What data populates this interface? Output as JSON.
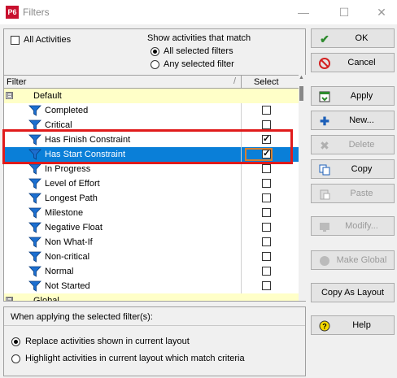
{
  "window": {
    "app_badge": "P6",
    "title": "Filters",
    "minimize_glyph": "—",
    "maximize_glyph": "☐",
    "close_glyph": "✕"
  },
  "options": {
    "all_activities_label": "All Activities",
    "all_activities_checked": false,
    "show_match_label": "Show activities that match",
    "all_selected_label": "All selected filters",
    "any_selected_label": "Any selected filter",
    "match_mode": "all"
  },
  "grid": {
    "col_filter": "Filter",
    "col_sort_glyph": "/",
    "col_select": "Select",
    "groups": [
      {
        "label": "Default",
        "expander": "⊟"
      },
      {
        "label": "Global",
        "expander": "⊟"
      }
    ],
    "items": [
      {
        "label": "Completed",
        "checked": false,
        "selected": false
      },
      {
        "label": "Critical",
        "checked": false,
        "selected": false
      },
      {
        "label": "Has Finish Constraint",
        "checked": true,
        "selected": false
      },
      {
        "label": "Has Start Constraint",
        "checked": true,
        "selected": true
      },
      {
        "label": "In Progress",
        "checked": false,
        "selected": false
      },
      {
        "label": "Level of Effort",
        "checked": false,
        "selected": false
      },
      {
        "label": "Longest Path",
        "checked": false,
        "selected": false
      },
      {
        "label": "Milestone",
        "checked": false,
        "selected": false
      },
      {
        "label": "Negative Float",
        "checked": false,
        "selected": false
      },
      {
        "label": "Non What-If",
        "checked": false,
        "selected": false
      },
      {
        "label": "Non-critical",
        "checked": false,
        "selected": false
      },
      {
        "label": "Normal",
        "checked": false,
        "selected": false
      },
      {
        "label": "Not Started",
        "checked": false,
        "selected": false
      }
    ]
  },
  "apply_mode": {
    "title": "When applying the selected filter(s):",
    "replace_label": "Replace activities shown in current layout",
    "highlight_label": "Highlight activities in current layout which match criteria",
    "mode": "replace"
  },
  "buttons": {
    "ok": {
      "label": "OK",
      "icon": "check-icon",
      "color": "#2e8b2e"
    },
    "cancel": {
      "label": "Cancel",
      "icon": "no-entry-icon",
      "color": "#d42020"
    },
    "apply": {
      "label": "Apply",
      "icon": "apply-icon"
    },
    "new": {
      "label": "New...",
      "icon": "plus-icon"
    },
    "delete": {
      "label": "Delete",
      "icon": "x-icon"
    },
    "copy": {
      "label": "Copy",
      "icon": "copy-icon"
    },
    "paste": {
      "label": "Paste",
      "icon": "paste-icon"
    },
    "modify": {
      "label": "Modify...",
      "icon": "modify-icon"
    },
    "make_global": {
      "label": "Make Global",
      "icon": "globe-icon"
    },
    "copy_as_layout": {
      "label": "Copy As Layout"
    },
    "help": {
      "label": "Help",
      "icon": "help-icon"
    }
  },
  "colors": {
    "selection": "#0a7fd8",
    "group_row": "#ffffc8",
    "highlight_annotation": "#e01b1b"
  }
}
